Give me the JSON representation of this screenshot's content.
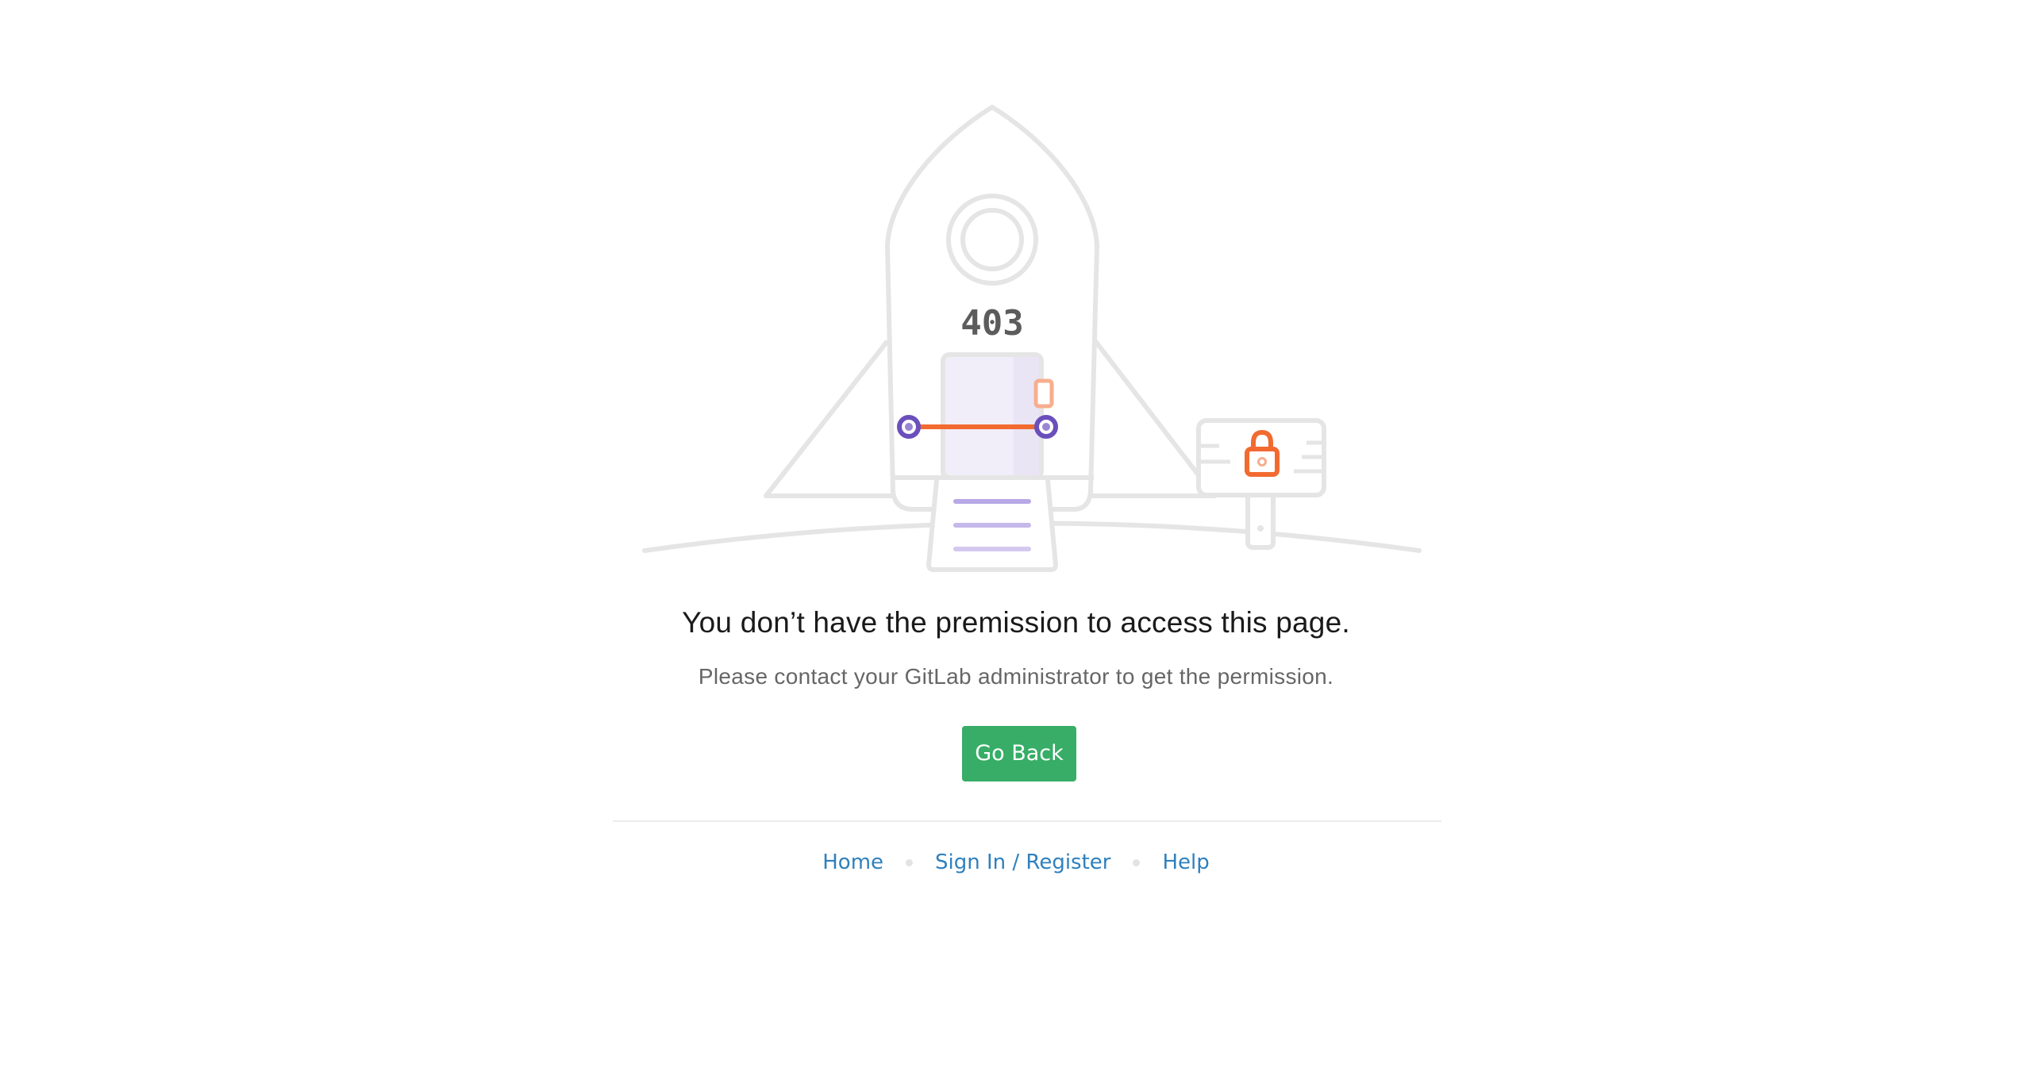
{
  "illustration": {
    "code": "403",
    "colors": {
      "outline": "#e5e5e5",
      "code": "#5c5c5c",
      "orange": "#f26a30",
      "orange_light": "#f7ae8e",
      "purple": "#6b4fbb",
      "purple_light": "#c5b8ea",
      "window_fill": "#f1eefa"
    }
  },
  "message": {
    "headline": "You don’t have the premission to access this page.",
    "subtext": "Please contact your GitLab administrator to get the permission."
  },
  "actions": {
    "go_back_label": "Go Back",
    "go_back_color": "#37ad67"
  },
  "footer": {
    "links": [
      {
        "label": "Home"
      },
      {
        "label": "Sign In / Register"
      },
      {
        "label": "Help"
      }
    ],
    "link_color": "#2f80bd"
  }
}
